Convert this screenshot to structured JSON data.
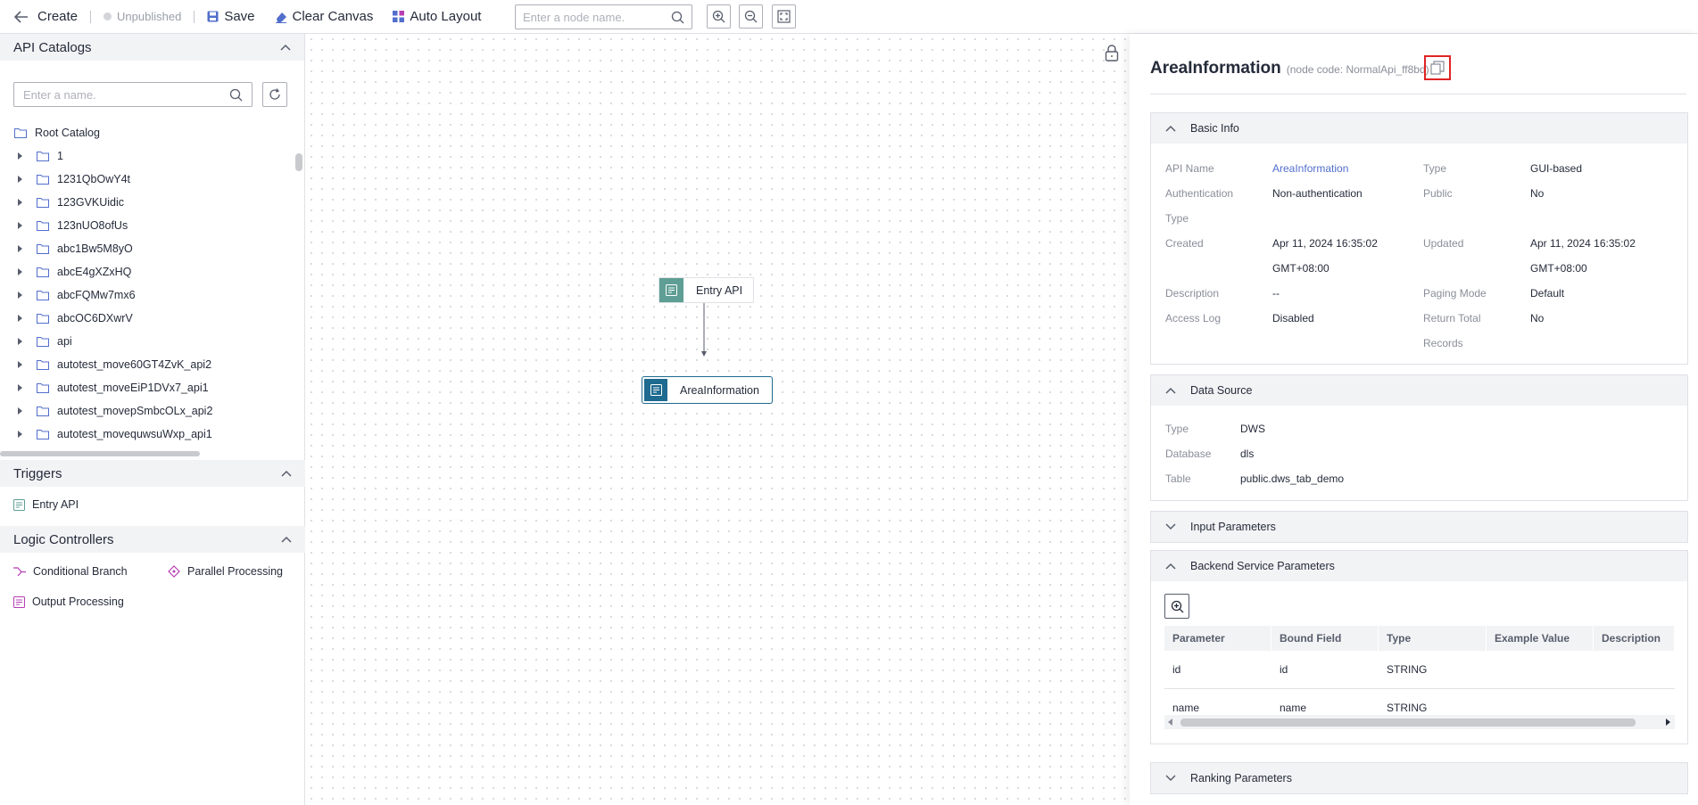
{
  "toolbar": {
    "create_label": "Create",
    "status_label": "Unpublished",
    "save_label": "Save",
    "clear_label": "Clear Canvas",
    "auto_layout_label": "Auto Layout",
    "node_search_placeholder": "Enter a node name."
  },
  "left": {
    "api_catalogs_title": "API Catalogs",
    "catalog_search_placeholder": "Enter a name.",
    "root_label": "Root Catalog",
    "catalogs": [
      "1",
      "1231QbOwY4t",
      "123GVKUidic",
      "123nUO8ofUs",
      "abc1Bw5M8yO",
      "abcE4gXZxHQ",
      "abcFQMw7mx6",
      "abcOC6DXwrV",
      "api",
      "autotest_move60GT4ZvK_api2",
      "autotest_moveEiP1DVx7_api1",
      "autotest_movepSmbcOLx_api2",
      "autotest_movequwsuWxp_api1"
    ],
    "triggers_title": "Triggers",
    "entry_api_label": "Entry API",
    "logic_title": "Logic Controllers",
    "conditional_label": "Conditional Branch",
    "parallel_label": "Parallel Processing",
    "output_label": "Output Processing"
  },
  "canvas": {
    "entry_node_label": "Entry API",
    "area_node_label": "AreaInformation"
  },
  "detail": {
    "title": "AreaInformation",
    "node_code": "(node code: NormalApi_ff8bd)",
    "basic": {
      "section_title": "Basic Info",
      "api_name_key": "API Name",
      "api_name_val": "AreaInformation",
      "type_key": "Type",
      "type_val": "GUI-based",
      "auth_key_1": "Authentication",
      "auth_key_2": "Type",
      "auth_val": "Non-authentication",
      "public_key": "Public",
      "public_val": "No",
      "created_key": "Created",
      "created_val_1": "Apr 11, 2024 16:35:02",
      "created_val_2": "GMT+08:00",
      "updated_key": "Updated",
      "updated_val_1": "Apr 11, 2024 16:35:02",
      "updated_val_2": "GMT+08:00",
      "desc_key": "Description",
      "desc_val": "--",
      "paging_key": "Paging Mode",
      "paging_val": "Default",
      "access_key": "Access Log",
      "access_val": "Disabled",
      "rt_key_1": "Return Total",
      "rt_key_2": "Records",
      "rt_val": "No"
    },
    "datasource": {
      "section_title": "Data Source",
      "type_key": "Type",
      "type_val": "DWS",
      "db_key": "Database",
      "db_val": "dls",
      "table_key": "Table",
      "table_val": "public.dws_tab_demo"
    },
    "input_title": "Input Parameters",
    "backend": {
      "section_title": "Backend Service Parameters",
      "headers": [
        "Parameter",
        "Bound Field",
        "Type",
        "Example Value",
        "Description"
      ],
      "rows": [
        [
          "id",
          "id",
          "STRING",
          "",
          ""
        ],
        [
          "name",
          "name",
          "STRING",
          "",
          ""
        ]
      ]
    },
    "ranking_title": "Ranking Parameters"
  },
  "colors": {
    "accent": "#526ecc",
    "trigger_green": "#5e9e94",
    "node_blue": "#1f6a8f",
    "highlight_red": "#e02424",
    "logic_purple": "#b63fb3"
  }
}
